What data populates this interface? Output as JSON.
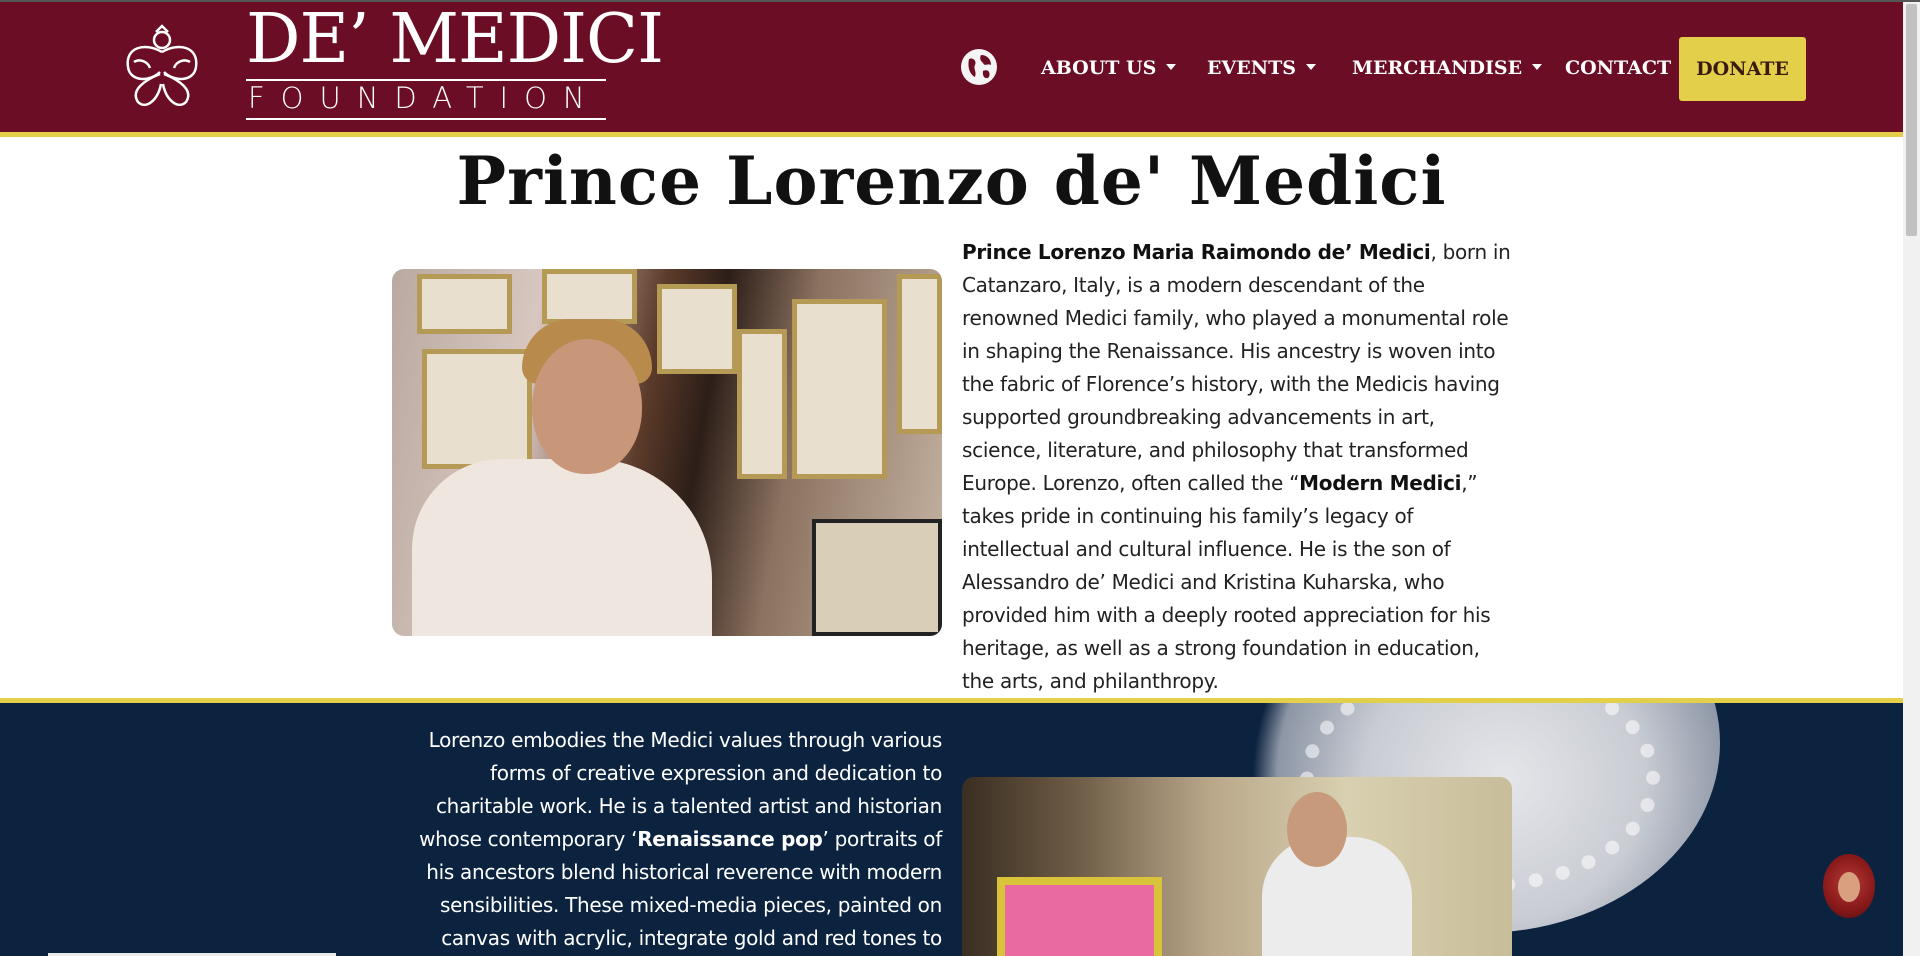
{
  "header": {
    "logo_main": "DE’ MEDICI",
    "logo_sub": "FOUNDATION",
    "nav": {
      "about": "ABOUT US",
      "events": "EVENTS",
      "merchandise": "MERCHANDISE",
      "contact": "CONTACT",
      "donate": "DONATE"
    }
  },
  "page": {
    "title": "Prince Lorenzo de' Medici"
  },
  "para1": {
    "name": "Prince Lorenzo Maria Raimondo de’ Medici",
    "part1": ", born in Catanzaro, Italy, is a modern descendant of the renowned Medici family, who played a monumental role in shaping the Renaissance. His ancestry is woven into the fabric of Florence’s history, with the Medicis having supported groundbreaking advancements in art, science, literature, and philosophy that transformed Europe. Lorenzo, often called the “",
    "nickname": "Modern Medici",
    "part2": ",” takes pride in continuing his family’s legacy of intellectual and cultural influence. He is the son of Alessandro de’ Medici and Kristina Kuharska, who provided him with a deeply rooted appreciation for his heritage, as well as a strong foundation in education, the arts, and philanthropy."
  },
  "para2": {
    "part1": "Lorenzo embodies the Medici values through various forms of creative expression and dedication to charitable work. He is a talented artist and historian whose contemporary ‘",
    "highlight": "Renaissance pop",
    "part2": "’ portraits of his ancestors blend historical reverence with modern sensibilities. These mixed-media pieces, painted on canvas with acrylic, integrate gold and red tones to evoke"
  },
  "colors": {
    "header_bg": "#6b0d24",
    "accent_gold": "#e4cf4a",
    "dark_bg": "#0c2340"
  },
  "icons": {
    "globe": "globe-icon",
    "chat": "chat-avatar-icon"
  }
}
